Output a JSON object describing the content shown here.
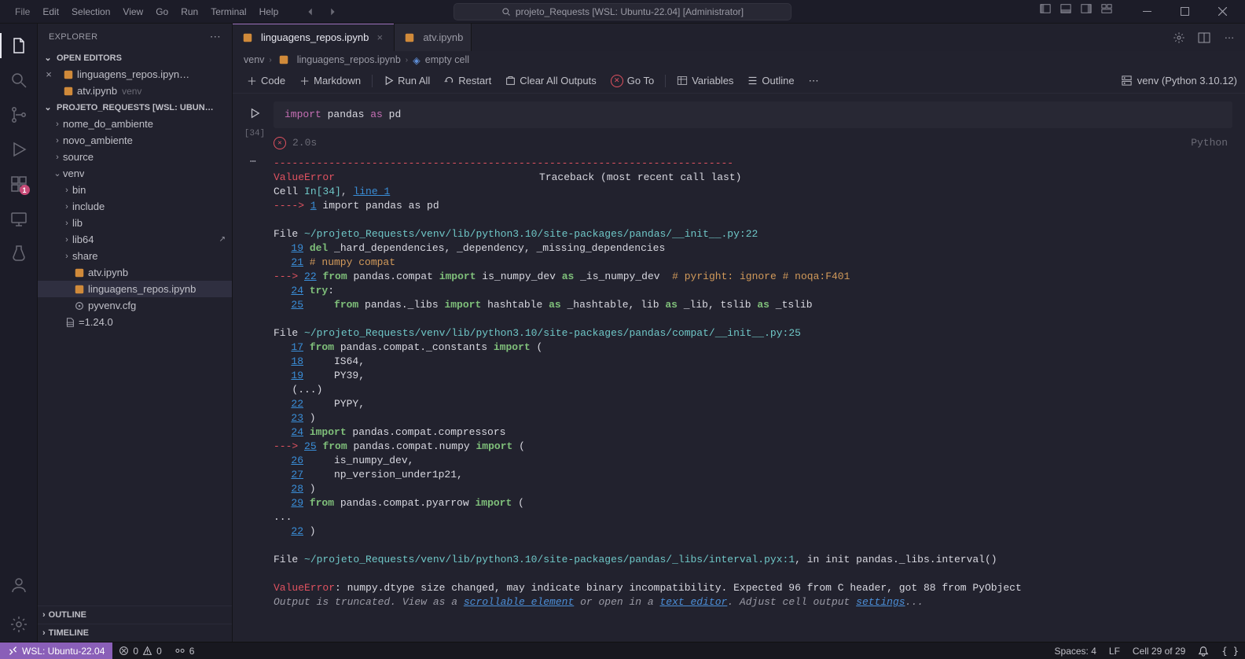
{
  "titlebar": {
    "app_title": "projeto_Requests [WSL: Ubuntu-22.04] [Administrator]",
    "menus": [
      "File",
      "Edit",
      "Selection",
      "View",
      "Go",
      "Run",
      "Terminal",
      "Help"
    ]
  },
  "tabs": {
    "active": "linguagens_repos.ipynb",
    "inactive": "atv.ipynb"
  },
  "tab_actions": {
    "gear": "gear",
    "split": "split",
    "more": "⋯"
  },
  "sidebar": {
    "title": "EXPLORER",
    "open_editors": "OPEN EDITORS",
    "open_items": [
      {
        "label": "linguagens_repos.ipyn…",
        "close": true
      },
      {
        "label": "atv.ipynb",
        "meta": "venv"
      }
    ],
    "project_label": "PROJETO_REQUESTS [WSL: UBUN…",
    "tree": [
      {
        "type": "folder",
        "label": "nome_do_ambiente",
        "depth": 1
      },
      {
        "type": "folder",
        "label": "novo_ambiente",
        "depth": 1
      },
      {
        "type": "folder",
        "label": "source",
        "depth": 1
      },
      {
        "type": "folder-open",
        "label": "venv",
        "depth": 1
      },
      {
        "type": "folder",
        "label": "bin",
        "depth": 2
      },
      {
        "type": "folder",
        "label": "include",
        "depth": 2
      },
      {
        "type": "folder",
        "label": "lib",
        "depth": 2
      },
      {
        "type": "folder",
        "label": "lib64",
        "depth": 2,
        "link": true
      },
      {
        "type": "folder",
        "label": "share",
        "depth": 2
      },
      {
        "type": "nb",
        "label": "atv.ipynb",
        "depth": 2
      },
      {
        "type": "nb",
        "label": "linguagens_repos.ipynb",
        "depth": 2,
        "sel": true
      },
      {
        "type": "cfg",
        "label": "pyvenv.cfg",
        "depth": 2
      },
      {
        "type": "txt",
        "label": "=1.24.0",
        "depth": 1
      }
    ],
    "outline": "OUTLINE",
    "timeline": "TIMELINE"
  },
  "breadcrumb": {
    "seg1": "venv",
    "seg2": "linguagens_repos.ipynb",
    "seg3": "empty cell"
  },
  "nbtoolbar": {
    "code": "Code",
    "markdown": "Markdown",
    "run_all": "Run All",
    "restart": "Restart",
    "clear": "Clear All Outputs",
    "goto": "Go To",
    "vars": "Variables",
    "outline": "Outline",
    "more": "⋯",
    "kernel": "venv (Python 3.10.12)"
  },
  "cell": {
    "exec_count": "[34]",
    "code": "import pandas as pd",
    "duration": "2.0s",
    "lang": "Python",
    "more": "⋯"
  },
  "out": {
    "dashes": "---------------------------------------------------------------------------",
    "errname": "ValueError",
    "traceback": "Traceback (most recent call last)",
    "cell_label": "Cell ",
    "in_label": "In[34]",
    "comma": ", ",
    "line1_link": "line 1",
    "arrow1": "----> ",
    "ln1": "1",
    "code1": " import pandas as pd",
    "file1": "~/projeto_Requests/venv/lib/python3.10/site-packages/pandas/__init__.py:22",
    "l19": "19",
    "t19": " del _hard_dependencies, _dependency, _missing_dependencies",
    "l21": "21",
    "t21": " # numpy compat",
    "arrow2": "---> ",
    "l22": "22",
    "t22": " from pandas.compat import is_numpy_dev as _is_numpy_dev  # pyright: ignore # noqa:F401",
    "l24": "24",
    "t24": " try:",
    "l25": "25",
    "t25": "     from pandas._libs import hashtable as _hashtable, lib as _lib, tslib as _tslib",
    "file2": "~/projeto_Requests/venv/lib/python3.10/site-packages/pandas/compat/__init__.py:25",
    "c17": "17",
    "ct17": " from pandas.compat._constants import (",
    "c18": "18",
    "ct18": "     IS64,",
    "c19": "19",
    "ct19": "     PY39,",
    "dots1": "   (...)",
    "c22": "22",
    "ct22": "     PYPY,",
    "c23": "23",
    "ct23": " )",
    "c24": "24",
    "ct24": " import pandas.compat.compressors",
    "c25": "25",
    "ct25": " from pandas.compat.numpy import (",
    "c26": "26",
    "ct26": "     is_numpy_dev,",
    "c27": "27",
    "ct27": "     np_version_under1p21,",
    "c28": "28",
    "ct28": " )",
    "c29": "29",
    "ct29": " from pandas.compat.pyarrow import (",
    "dots2": "...",
    "c22b": "22",
    "ct22b": " )",
    "file3_a": "~/projeto_Requests/venv/lib/python3.10/site-packages/pandas/_libs/interval.pyx:1",
    "file3_b": ", in ",
    "file3_c": "init pandas._libs.interval",
    "file3_d": "()",
    "final_err": "ValueError",
    "final_msg": ": numpy.dtype size changed, may indicate binary incompatibility. Expected 96 from C header, got 88 from PyObject",
    "trunc1": "Output is truncated. View as a ",
    "trunc_link1": "scrollable element",
    "trunc2": " or open in a ",
    "trunc_link2": "text editor",
    "trunc3": ". Adjust cell output ",
    "trunc_link3": "settings",
    "trunc4": "..."
  },
  "statusbar": {
    "remote": "WSL: Ubuntu-22.04",
    "errors": "0",
    "warnings": "0",
    "ports": "6",
    "spaces": "Spaces: 4",
    "eol": "LF",
    "cell": "Cell 29 of 29"
  }
}
